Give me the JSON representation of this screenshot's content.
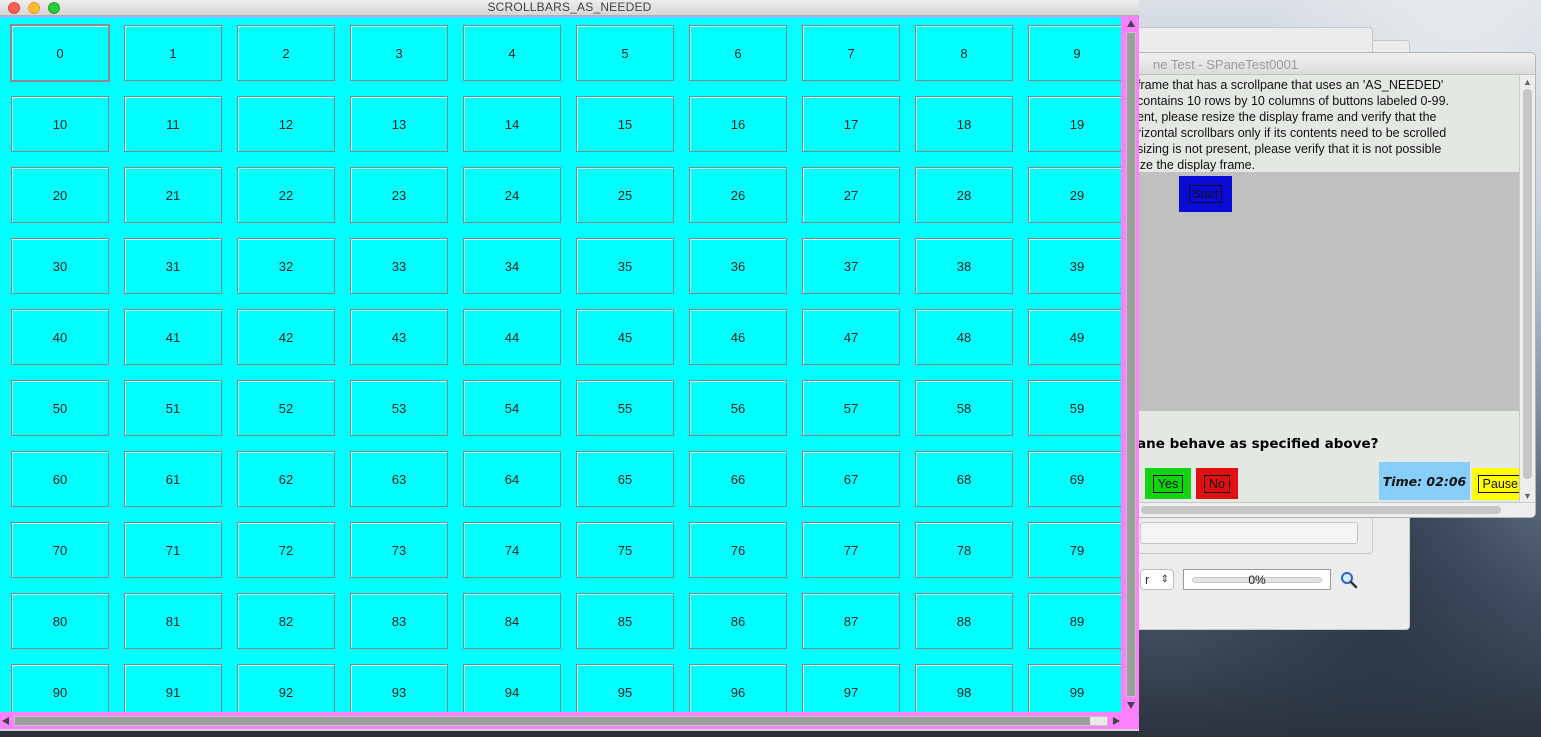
{
  "main_window": {
    "title": "SCROLLBARS_AS_NEEDED",
    "buttons": [
      "0",
      "1",
      "2",
      "3",
      "4",
      "5",
      "6",
      "7",
      "8",
      "9",
      "10",
      "11",
      "12",
      "13",
      "14",
      "15",
      "16",
      "17",
      "18",
      "19",
      "20",
      "21",
      "22",
      "23",
      "24",
      "25",
      "26",
      "27",
      "28",
      "29",
      "30",
      "31",
      "32",
      "33",
      "34",
      "35",
      "36",
      "37",
      "38",
      "39",
      "40",
      "41",
      "42",
      "43",
      "44",
      "45",
      "46",
      "47",
      "48",
      "49",
      "50",
      "51",
      "52",
      "53",
      "54",
      "55",
      "56",
      "57",
      "58",
      "59",
      "60",
      "61",
      "62",
      "63",
      "64",
      "65",
      "66",
      "67",
      "68",
      "69",
      "70",
      "71",
      "72",
      "73",
      "74",
      "75",
      "76",
      "77",
      "78",
      "79",
      "80",
      "81",
      "82",
      "83",
      "84",
      "85",
      "86",
      "87",
      "88",
      "89",
      "90",
      "91",
      "92",
      "93",
      "94",
      "95",
      "96",
      "97",
      "98",
      "99"
    ],
    "colors": {
      "background": "#00ffff",
      "frame": "#ff80ff"
    }
  },
  "test_window": {
    "title": "ne Test - SPaneTest0001",
    "instructions": [
      " frame that has a scrollpane that uses an 'AS_NEEDED'",
      "contains 10 rows by 10 columns of buttons labeled 0-99.",
      "ent, please resize the display frame and verify that the",
      "rizontal scrollbars only if its contents need to be scrolled",
      "sizing is not present, please verify that it is not possible",
      "ize the display frame."
    ],
    "start_label": "Start",
    "question": "ane behave as specified above?",
    "yes_label": "Yes",
    "no_label": "No",
    "time": "Time: 02:06",
    "pause_label": "Pause",
    "colors": {
      "start": "#0b0bd8",
      "yes": "#11d311",
      "no": "#e01010",
      "time": "#87cefa",
      "pause": "#ffff00"
    }
  },
  "background_window": {
    "select_value": "r",
    "progress_text": "0%",
    "progress_value": 0,
    "search_icon": "magnifier-icon"
  }
}
